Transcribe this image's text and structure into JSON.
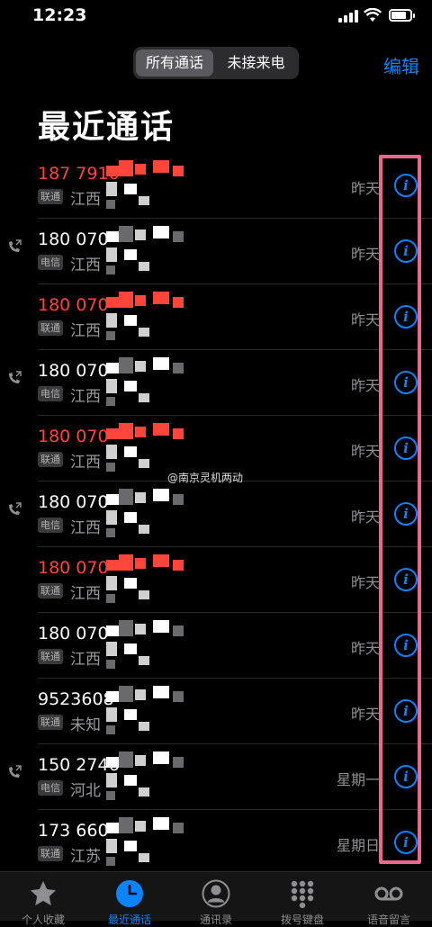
{
  "status": {
    "time": "12:23"
  },
  "header": {
    "segments": [
      "所有通话",
      "未接来电"
    ],
    "edit_label": "编辑",
    "title": "最近通话"
  },
  "calls": [
    {
      "number": "187 7910",
      "missed": true,
      "outgoing": false,
      "carrier": "联通",
      "region": "江西",
      "when": "昨天"
    },
    {
      "number": "180 070",
      "missed": false,
      "outgoing": true,
      "carrier": "电信",
      "region": "江西",
      "when": "昨天"
    },
    {
      "number": "180 070",
      "missed": true,
      "outgoing": false,
      "carrier": "联通",
      "region": "江西",
      "when": "昨天"
    },
    {
      "number": "180 070",
      "missed": false,
      "outgoing": true,
      "carrier": "电信",
      "region": "江西",
      "when": "昨天"
    },
    {
      "number": "180 070",
      "missed": true,
      "outgoing": false,
      "carrier": "联通",
      "region": "江西",
      "when": "昨天"
    },
    {
      "number": "180 070",
      "missed": false,
      "outgoing": true,
      "carrier": "电信",
      "region": "江西",
      "when": "昨天"
    },
    {
      "number": "180 070",
      "missed": true,
      "outgoing": false,
      "carrier": "联通",
      "region": "江西",
      "when": "昨天"
    },
    {
      "number": "180 070",
      "missed": false,
      "outgoing": false,
      "carrier": "联通",
      "region": "江西",
      "when": "昨天"
    },
    {
      "number": "9523608",
      "missed": false,
      "outgoing": false,
      "carrier": "联通",
      "region": "未知",
      "when": "昨天"
    },
    {
      "number": "150 2746",
      "missed": false,
      "outgoing": true,
      "carrier": "电信",
      "region": "河北",
      "when": "星期一"
    },
    {
      "number": "173 660",
      "missed": false,
      "outgoing": false,
      "carrier": "联通",
      "region": "江苏",
      "when": "星期日"
    }
  ],
  "watermark": "@南京灵机两动",
  "tabs": [
    {
      "label": "个人收藏",
      "icon": "star-icon"
    },
    {
      "label": "最近通话",
      "icon": "clock-icon",
      "active": true
    },
    {
      "label": "通讯录",
      "icon": "person-icon"
    },
    {
      "label": "拨号键盘",
      "icon": "keypad-icon"
    },
    {
      "label": "语音留言",
      "icon": "voicemail-icon"
    }
  ],
  "colors": {
    "accent": "#0a84ff",
    "missed": "#ff453a",
    "highlight": "#e8688e"
  }
}
